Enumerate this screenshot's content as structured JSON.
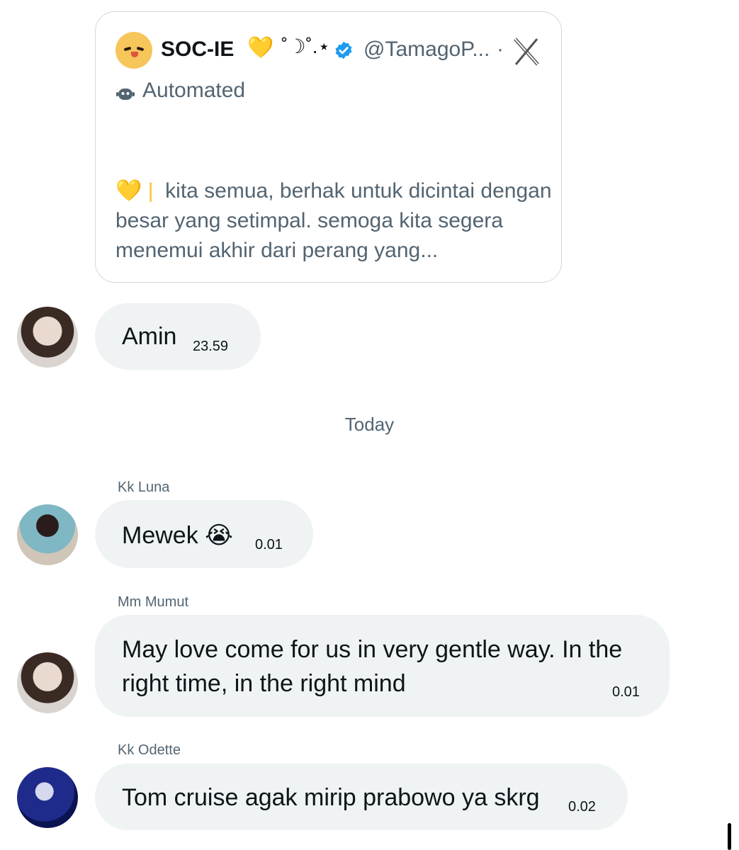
{
  "quoted_post": {
    "display_name": "SOC-IE",
    "name_emoji": "💛",
    "name_decoration": "˚☽˚.⋆",
    "handle": "@TamagoP...",
    "separator": "·",
    "badge_label": "Automated",
    "body_prefix": "💛  |",
    "body_text": "kita semua, berhak untuk dicintai dengan besar yang setimpal. semoga kita segera menemui akhir dari perang yang...",
    "icons": {
      "avatar": "tamago-avatar-icon",
      "verified": "verified-badge-icon",
      "platform": "x-logo-icon",
      "automated": "robot-icon"
    }
  },
  "day_separator": "Today",
  "messages": [
    {
      "sender": "",
      "text": "Amin",
      "time": "23.59"
    },
    {
      "sender": "Kk Luna",
      "text": "Mewek 😭",
      "time": "0.01"
    },
    {
      "sender": "Mm Mumut",
      "text_line1": "May love come for us in very gentle way. In the",
      "text_line2": "right time, in the right mind",
      "time": "0.01"
    },
    {
      "sender": "Kk Odette",
      "text": "Tom cruise agak mirip prabowo ya skrg",
      "time": "0.02"
    }
  ],
  "colors": {
    "bubble": "#eff3f4",
    "secondary_text": "#536471",
    "verified_blue": "#1d9bf0"
  }
}
